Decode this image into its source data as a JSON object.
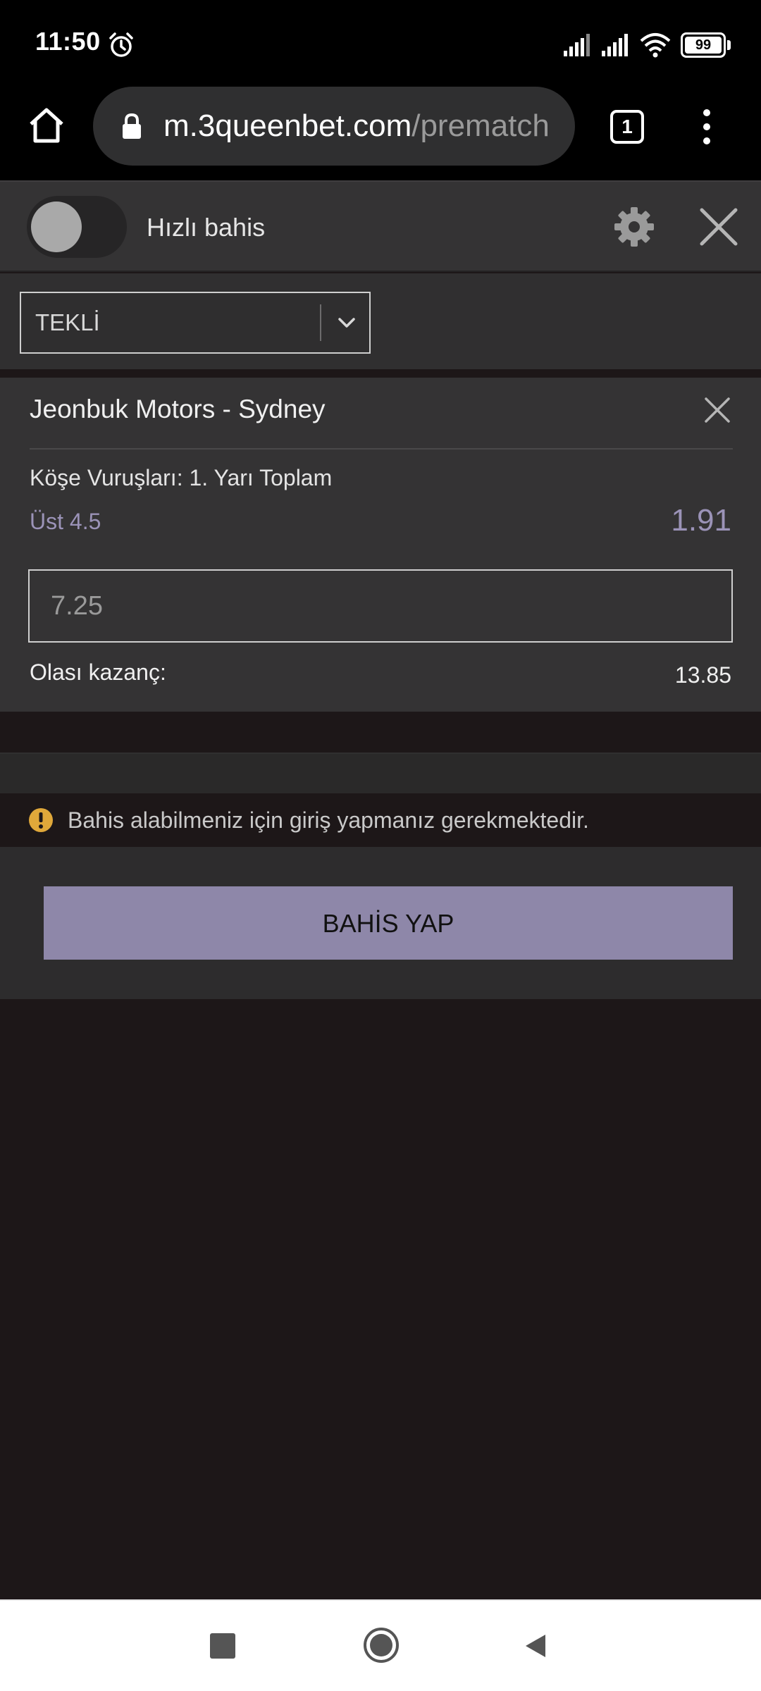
{
  "status_bar": {
    "time": "11:50",
    "battery": "99",
    "icons": [
      "alarm-icon",
      "signal-icon",
      "signal-icon",
      "wifi-icon",
      "battery-icon"
    ]
  },
  "browser": {
    "url_host": "m.3queenbet.com",
    "url_path": "/prematch",
    "tab_count": "1"
  },
  "slip_header": {
    "quick_bet_label": "Hızlı bahis",
    "quick_bet_enabled": false
  },
  "bet_type": {
    "selected": "TEKLİ"
  },
  "bet": {
    "match": "Jeonbuk Motors - Sydney",
    "market": "Köşe Vuruşları: 1. Yarı Toplam",
    "selection": "Üst 4.5",
    "odds": "1.91",
    "stake": "7.25",
    "winnings_label": "Olası kazanç:",
    "winnings_value": "13.85"
  },
  "warning": {
    "text": "Bahis alabilmeniz için giriş yapmanız gerekmektedir."
  },
  "actions": {
    "place_bet_label": "BAHİS YAP"
  },
  "colors": {
    "accent": "#8e87a9",
    "odds": "#9b93b8",
    "warning": "#e0a83a",
    "background": "#1d1718",
    "panel": "#343334"
  }
}
